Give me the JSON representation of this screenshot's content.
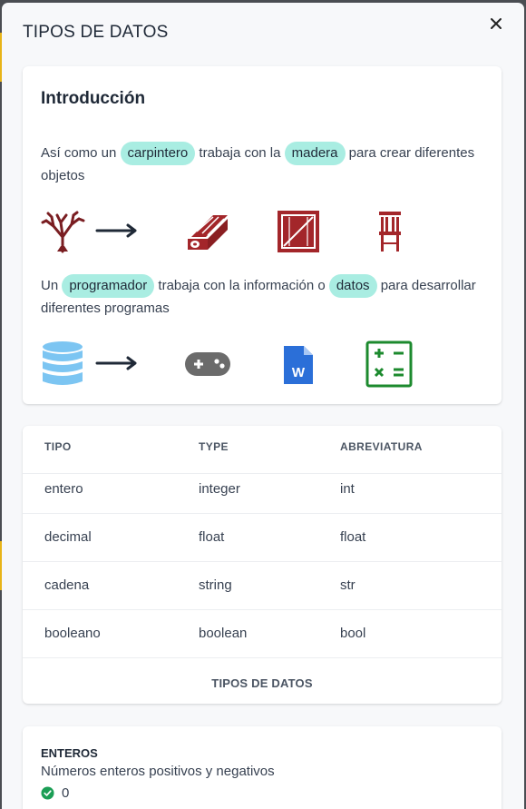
{
  "modal": {
    "title": "TIPOS DE DATOS",
    "close_icon": "close-icon"
  },
  "intro": {
    "heading": "Introducción",
    "para1": {
      "t1": "Así como un ",
      "chip1": "carpintero",
      "t2": " trabaja con la ",
      "chip2": "madera",
      "t3": " para crear diferentes objetos"
    },
    "row1_icons": [
      "tree-icon",
      "arrow-right-icon",
      "lumber-icon",
      "crate-icon",
      "chair-icon"
    ],
    "para2": {
      "t1": "Un ",
      "chip1": "programador",
      "t2": " trabaja con la información o ",
      "chip2": "datos",
      "t3": " para desarrollar diferentes programas"
    },
    "row2_icons": [
      "database-icon",
      "arrow-right-icon",
      "gamepad-icon",
      "word-document-icon",
      "calculator-icon"
    ]
  },
  "table": {
    "headers": [
      "TIPO",
      "TYPE",
      "ABREVIATURA"
    ],
    "rows": [
      [
        "entero",
        "integer",
        "int"
      ],
      [
        "decimal",
        "float",
        "float"
      ],
      [
        "cadena",
        "string",
        "str"
      ],
      [
        "booleano",
        "boolean",
        "bool"
      ]
    ],
    "caption": "TIPOS DE DATOS"
  },
  "section": {
    "title": "ENTEROS",
    "description": "Números enteros positivos y negativos",
    "value": "0",
    "value_icon": "check-circle-icon"
  },
  "colors": {
    "chip": "#a9ede2",
    "wood": "#a3262a",
    "database": "#7cc5f2",
    "word": "#2b6fd8",
    "calculator": "#1c8a2e",
    "check": "#1b9e55"
  }
}
